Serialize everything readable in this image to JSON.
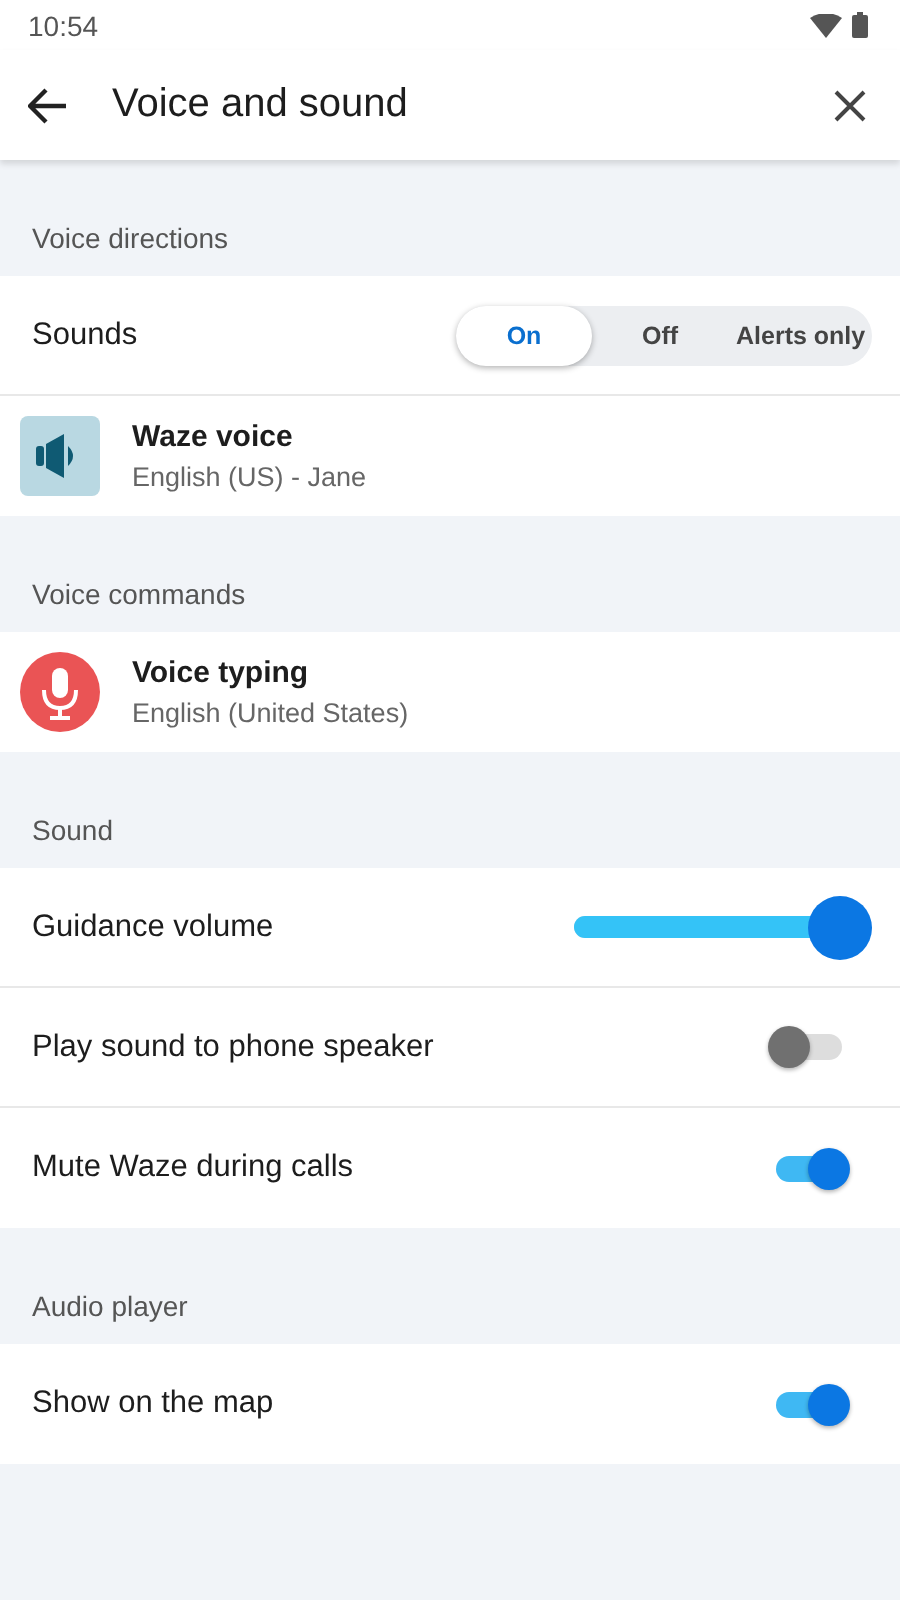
{
  "status_bar": {
    "time": "10:54"
  },
  "header": {
    "title": "Voice and sound"
  },
  "sections": [
    {
      "title": "Voice directions",
      "rows": [
        {
          "kind": "segmented",
          "label": "Sounds",
          "options": [
            {
              "label": "On",
              "selected": true
            },
            {
              "label": "Off",
              "selected": false
            },
            {
              "label": "Alerts only",
              "selected": false
            }
          ]
        },
        {
          "kind": "speaker",
          "label": "Waze voice",
          "detail": "English (US) - Jane"
        }
      ]
    },
    {
      "title": "Voice commands",
      "rows": [
        {
          "kind": "microphone",
          "label": "Voice typing",
          "detail": "English (United States)"
        }
      ]
    },
    {
      "title": "Sound",
      "rows": [
        {
          "kind": "slider",
          "label": "Guidance volume",
          "level": 1
        },
        {
          "kind": "toggle",
          "label": "Play sound to phone speaker",
          "on": false
        },
        {
          "kind": "toggle",
          "label": "Mute Waze during calls",
          "on": true
        }
      ]
    },
    {
      "title": "Audio player",
      "rows": [
        {
          "kind": "toggle",
          "label": "Show on the map",
          "on": true
        }
      ]
    }
  ]
}
